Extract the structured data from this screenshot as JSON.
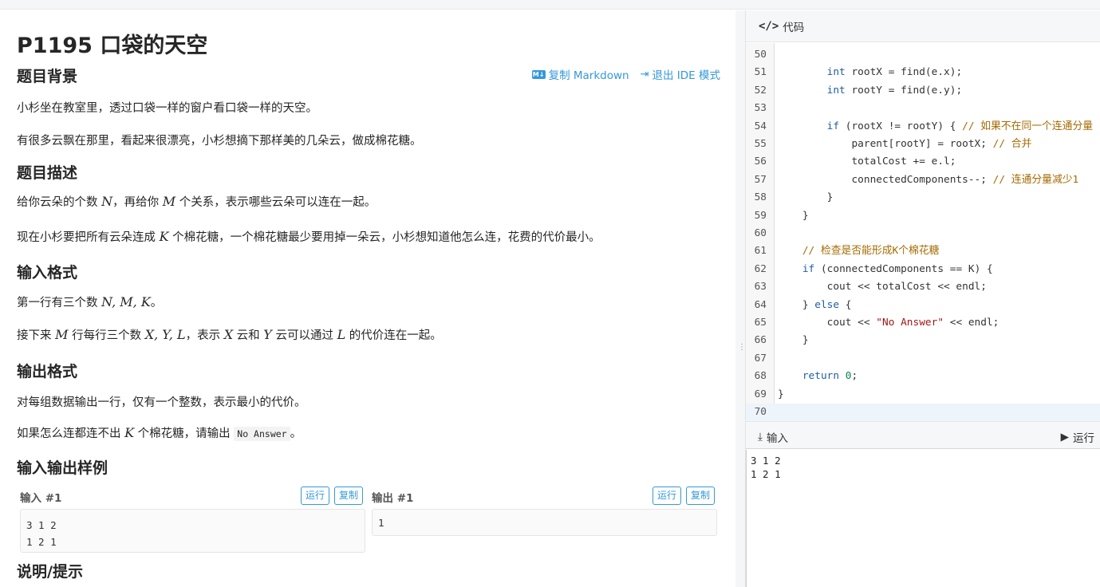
{
  "problem": {
    "title": "P1195 口袋的天空",
    "copy_markdown": "复制 Markdown",
    "exit_ide": "退出 IDE 模式",
    "md_badge": "M↓",
    "background_h": "题目背景",
    "background_p1": "小杉坐在教室里，透过口袋一样的窗户看口袋一样的天空。",
    "background_p2": "有很多云飘在那里，看起来很漂亮，小杉想摘下那样美的几朵云，做成棉花糖。",
    "desc_h": "题目描述",
    "desc_p1": [
      "给你云朵的个数 ",
      "N",
      "，再给你 ",
      "M",
      " 个关系，表示哪些云朵可以连在一起。"
    ],
    "desc_p2": [
      "现在小杉要把所有云朵连成 ",
      "K",
      " 个棉花糖，一个棉花糖最少要用掉一朵云，小杉想知道他怎么连，花费的代价最小。"
    ],
    "input_h": "输入格式",
    "input_p1": [
      "第一行有三个数 ",
      "N, M, K",
      "。"
    ],
    "input_p2": [
      "接下来 ",
      "M",
      " 行每行三个数 ",
      "X, Y, L",
      "，表示 ",
      "X",
      " 云和 ",
      "Y",
      " 云可以通过 ",
      "L",
      " 的代价连在一起。"
    ],
    "output_h": "输出格式",
    "output_p1": "对每组数据输出一行，仅有一个整数，表示最小的代价。",
    "output_p2": [
      "如果怎么连都连不出 ",
      "K",
      " 个棉花糖，请输出 ",
      "No Answer",
      "。"
    ],
    "samples_h": "输入输出样例",
    "input_label": "输入 #1",
    "output_label": "输出 #1",
    "run_label": "运行",
    "copy_label": "复制",
    "sample_input": "3 1 2\n1 2 1",
    "sample_output": "1",
    "hint_h": "说明/提示"
  },
  "ide": {
    "header_label": "代码",
    "code_lines": [
      {
        "n": "50",
        "t": ""
      },
      {
        "n": "51",
        "t": "        <span class='kw'>int</span> rootX = find(e.x);"
      },
      {
        "n": "52",
        "t": "        <span class='kw'>int</span> rootY = find(e.y);"
      },
      {
        "n": "53",
        "t": ""
      },
      {
        "n": "54",
        "t": "        <span class='kw'>if</span> (rootX != rootY) { <span class='cm'>// 如果不在同一个连通分量</span>"
      },
      {
        "n": "55",
        "t": "            parent[rootY] = rootX; <span class='cm'>// 合并</span>"
      },
      {
        "n": "56",
        "t": "            totalCost += e.l;"
      },
      {
        "n": "57",
        "t": "            connectedComponents--; <span class='cm'>// 连通分量减少1</span>"
      },
      {
        "n": "58",
        "t": "        }"
      },
      {
        "n": "59",
        "t": "    }"
      },
      {
        "n": "60",
        "t": ""
      },
      {
        "n": "61",
        "t": "    <span class='cm'>// 检查是否能形成K个棉花糖</span>"
      },
      {
        "n": "62",
        "t": "    <span class='kw'>if</span> (connectedComponents == K) {"
      },
      {
        "n": "63",
        "t": "        cout &lt;&lt; totalCost &lt;&lt; endl;"
      },
      {
        "n": "64",
        "t": "    } <span class='kw'>else</span> {"
      },
      {
        "n": "65",
        "t": "        cout &lt;&lt; <span class='st'>\"No Answer\"</span> &lt;&lt; endl;"
      },
      {
        "n": "66",
        "t": "    }"
      },
      {
        "n": "67",
        "t": ""
      },
      {
        "n": "68",
        "t": "    <span class='kw'>return</span> <span class='nm'>0</span>;"
      },
      {
        "n": "69",
        "t": "}"
      },
      {
        "n": "70",
        "t": ""
      }
    ],
    "active_line": "70",
    "input_label": "输入",
    "run_label": "运行",
    "input_value": "3 1 2\n1 2 1"
  },
  "icons": {
    "code": "code-icon",
    "markdown": "markdown-icon",
    "exit": "exit-icon",
    "input": "download-icon",
    "run": "play-icon",
    "grip": "drag-handle-icon"
  },
  "colors": {
    "accent": "#3498db",
    "keyword": "#1f5fa5",
    "comment": "#a56a00",
    "string": "#a31515"
  }
}
